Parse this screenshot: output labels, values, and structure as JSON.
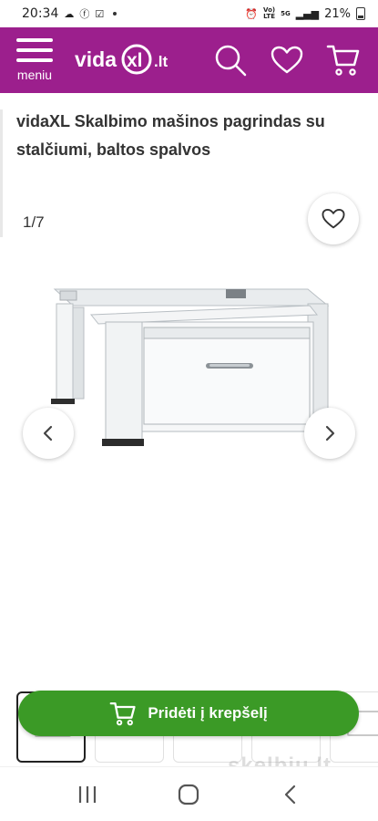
{
  "status_bar": {
    "time": "20:34",
    "battery": "21%",
    "network_top": "Vo)",
    "network_bottom": "LTE",
    "network_5g": "5G"
  },
  "header": {
    "menu_label": "meniu",
    "logo_text": "vidaXL.lt",
    "brand_color": "#9c1f8d",
    "icons": [
      "menu-icon",
      "search-icon",
      "heart-icon",
      "cart-icon"
    ]
  },
  "product": {
    "title": "vidaXL Skalbimo mašinos pagrindas su stalčiumi, baltos spalvos"
  },
  "gallery": {
    "counter": "1/7",
    "current_image": 1,
    "total_images": 7
  },
  "cart": {
    "add_label": "Pridėti į krepšelį",
    "button_color": "#3b9a26"
  },
  "watermark": "skelbiu.lt",
  "nav": {
    "icons": [
      "recent-apps-icon",
      "home-icon",
      "back-icon"
    ]
  }
}
